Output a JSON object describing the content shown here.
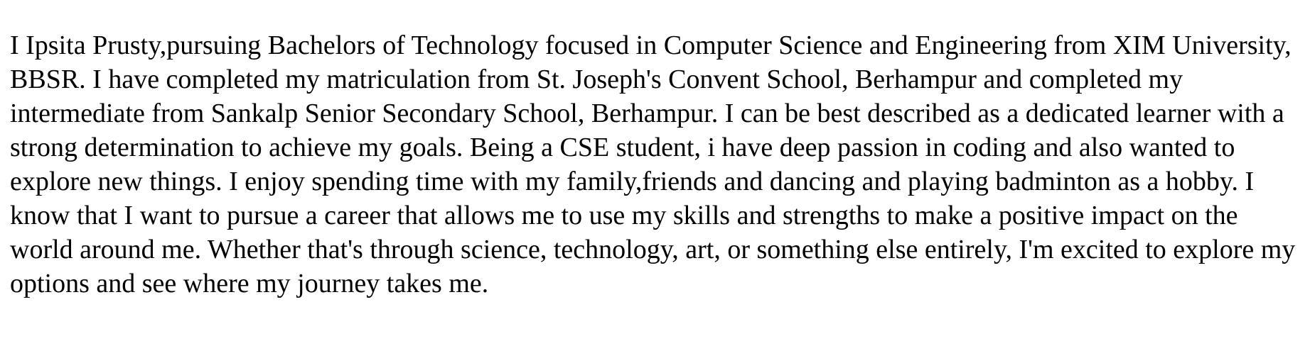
{
  "about": {
    "paragraph": "I Ipsita Prusty,pursuing Bachelors of Technology focused in Computer Science and Engineering from XIM University, BBSR. I have completed my matriculation from St. Joseph's Convent School, Berhampur and completed my intermediate from Sankalp Senior Secondary School, Berhampur. I can be best described as a dedicated learner with a strong determination to achieve my goals. Being a CSE student, i have deep passion in coding and also wanted to explore new things. I enjoy spending time with my family,friends and dancing and playing badminton as a hobby. I know that I want to pursue a career that allows me to use my skills and strengths to make a positive impact on the world around me. Whether that's through science, technology, art, or something else entirely, I'm excited to explore my options and see where my journey takes me."
  }
}
